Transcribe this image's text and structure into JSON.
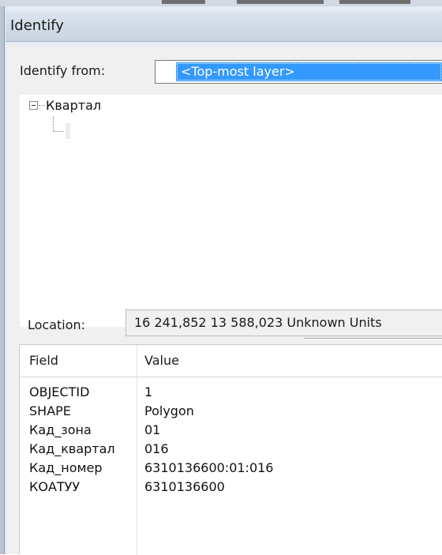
{
  "window": {
    "title": "Identify"
  },
  "identify_from": {
    "label": "Identify from:",
    "selected": "<Top-most layer>"
  },
  "tree": {
    "layers": [
      {
        "label": "Квартал"
      }
    ]
  },
  "location": {
    "label": "Location:",
    "value": "16 241,852  13 588,023 Unknown Units"
  },
  "attributes": {
    "columns": [
      "Field",
      "Value"
    ],
    "rows": [
      {
        "field": "OBJECTID",
        "value": "1"
      },
      {
        "field": "SHAPE",
        "value": "Polygon"
      },
      {
        "field": "Кад_зона",
        "value": "01"
      },
      {
        "field": "Кад_квартал",
        "value": "016"
      },
      {
        "field": "Кад_номер",
        "value": "6310136600:01:016"
      },
      {
        "field": "КОАТУУ",
        "value": "6310136600"
      }
    ]
  },
  "icons": {
    "tree_expander": "minus-box-icon"
  },
  "colors": {
    "selection": "#3399ff",
    "title_bar": "#cfdae7",
    "panel": "#f0f0f0"
  }
}
